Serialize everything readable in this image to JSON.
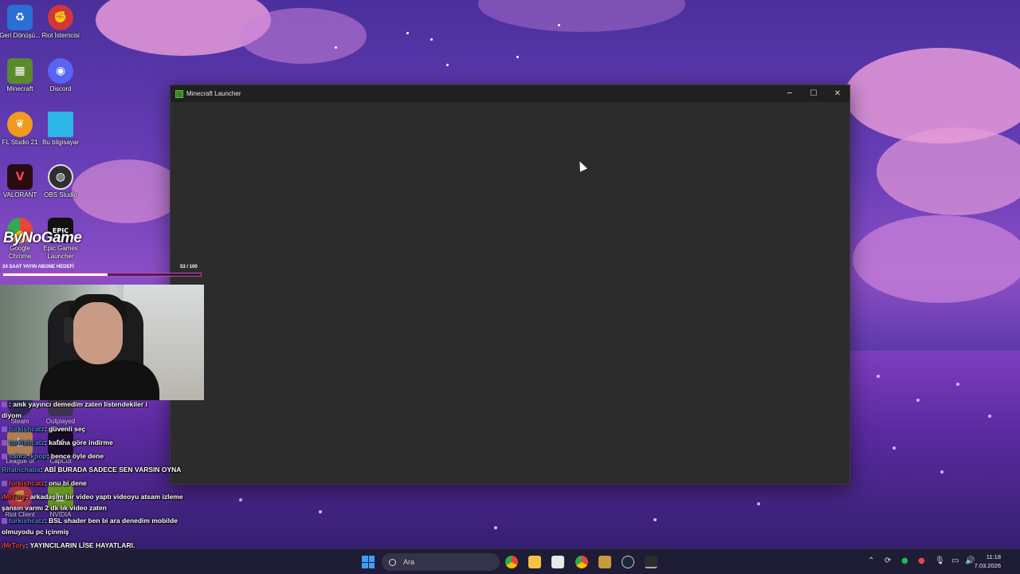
{
  "desktop": {
    "icons": [
      {
        "label": "Geri Dönüşü...",
        "icon": "recycle-bin-icon",
        "color": "#2a6fd6"
      },
      {
        "label": "Riot İstemcisi",
        "icon": "riot-client-icon",
        "color": "#d13639"
      },
      {
        "label": "Minecraft",
        "icon": "minecraft-icon",
        "color": "#5b8a2c"
      },
      {
        "label": "Discord",
        "icon": "discord-icon",
        "color": "#5865f2"
      },
      {
        "label": "FL Studio 21",
        "icon": "fl-studio-icon",
        "color": "#f29a1e"
      },
      {
        "label": "Bu bilgisayar",
        "icon": "this-pc-icon",
        "color": "#2bb5e8"
      },
      {
        "label": "VALORANT",
        "icon": "valorant-icon",
        "color": "#fa4454"
      },
      {
        "label": "OBS Studio",
        "icon": "obs-icon",
        "color": "#302e31"
      },
      {
        "label": "Google Chrome",
        "icon": "chrome-icon",
        "color": "#e8453c"
      },
      {
        "label": "Epic Games Launcher",
        "icon": "epic-games-icon",
        "color": "#111111"
      },
      {
        "label": "Steam",
        "icon": "steam-icon",
        "color": "#1b2838"
      },
      {
        "label": "Outplayed Reco...",
        "icon": "outplayed-icon",
        "color": "#333333"
      },
      {
        "label": "League of",
        "icon": "league-icon",
        "color": "#c89b3c"
      },
      {
        "label": "CapCut",
        "icon": "capcut-icon",
        "color": "#000000"
      },
      {
        "label": "Riot Client",
        "icon": "riot-client-icon",
        "color": "#d13639"
      },
      {
        "label": "NVIDIA",
        "icon": "nvidia-icon",
        "color": "#76b900"
      }
    ]
  },
  "window": {
    "title": "Minecraft Launcher",
    "controls": {
      "minimize": "─",
      "maximize": "☐",
      "close": "✕"
    }
  },
  "overlay": {
    "brand": "ByNoGame",
    "goal_label": "24 SAAT YAYIN ABONE HEDEFİ",
    "goal_count": "53  / 100",
    "goal_progress": 0.53
  },
  "chat": [
    {
      "user": "",
      "text": ": amk yayıncı demedim zaten listendekiler i",
      "user_color": "blue"
    },
    {
      "user": "",
      "text": "diyom",
      "user_color": "blue"
    },
    {
      "user": "turkishcatz",
      "text": ": güvenli seç",
      "user_color": "blue"
    },
    {
      "user": "turkishcatz",
      "text": ": kafana göre indirme",
      "user_color": "blue"
    },
    {
      "user": "sahra_kpop",
      "text": ": bence öyle dene",
      "user_color": "blue"
    },
    {
      "user": "Rifatnchaba",
      "text": ": ABİ BURADA SADECE SEN VARSIN OYNA",
      "user_color": "blue"
    },
    {
      "user": "turkishcatz",
      "text": ": onu bi dene",
      "user_color": "red"
    },
    {
      "user": "iMrTory",
      "text": ": arkadaşım bir video yaptı videoyu atsam izleme",
      "user_color": "red"
    },
    {
      "user": "",
      "text": "şansın varmı 2 dk lık video zaten",
      "user_color": "blue"
    },
    {
      "user": "turkishcatz",
      "text": ": BSL shader ben bi ara denedim mobilde",
      "user_color": "blue"
    },
    {
      "user": "",
      "text": "olmuyodu pc içinmiş",
      "user_color": "blue"
    },
    {
      "user": "iMrTory",
      "text": ": YAYINCILARIN LİSE HAYATLARI.",
      "user_color": "red"
    }
  ],
  "taskbar": {
    "search_placeholder": "Ara",
    "time": "11:18",
    "date": "7.03.2026",
    "apps": [
      "chrome-icon",
      "file-explorer-icon",
      "store-icon",
      "chrome-icon",
      "league-icon",
      "steam-icon",
      "minecraft-icon"
    ]
  }
}
